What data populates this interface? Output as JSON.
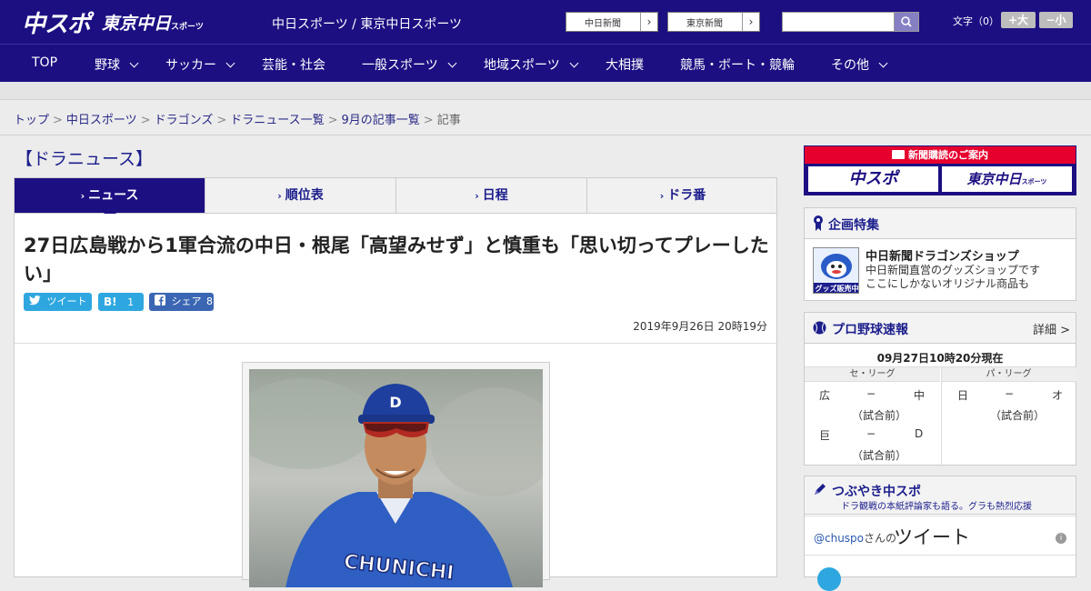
{
  "header": {
    "logo_main": "中スポ",
    "logo_tokyo": "東京中日",
    "logo_tokyo_sub": "スポーツ",
    "site_title": "中日スポーツ / 東京中日スポーツ",
    "btn_chunichi": "中日新聞",
    "btn_tokyo": "東京新聞",
    "btn_arrow": "›",
    "search_placeholder": "",
    "fontsize_label": "文字（0）",
    "fontsize_up": "+大",
    "fontsize_down": "−小"
  },
  "nav": [
    {
      "label": "TOP",
      "has_menu": false
    },
    {
      "label": "野球",
      "has_menu": true
    },
    {
      "label": "サッカー",
      "has_menu": true
    },
    {
      "label": "芸能・社会",
      "has_menu": false
    },
    {
      "label": "一般スポーツ",
      "has_menu": true
    },
    {
      "label": "地域スポーツ",
      "has_menu": true
    },
    {
      "label": "大相撲",
      "has_menu": false
    },
    {
      "label": "競馬・ボート・競輪",
      "has_menu": false
    },
    {
      "label": "その他",
      "has_menu": true
    }
  ],
  "breadcrumb": {
    "items": [
      "トップ",
      "中日スポーツ",
      "ドラゴンズ",
      "ドラニュース一覧",
      "9月の記事一覧"
    ],
    "current": "記事",
    "separator": ">"
  },
  "section": {
    "title": "【ドラニュース】"
  },
  "tabs": [
    {
      "label": "ニュース",
      "active": true
    },
    {
      "label": "順位表",
      "active": false
    },
    {
      "label": "日程",
      "active": false
    },
    {
      "label": "ドラ番",
      "active": false
    }
  ],
  "tab_mark": "›",
  "article": {
    "headline": "27日広島戦から1軍合流の中日・根尾「高望みせず」と慎重も「思い切ってプレーしたい」",
    "share_tweet": "ツイート",
    "share_hatena": "B!",
    "share_hatena_count": "1",
    "share_fb": "シェア",
    "share_fb_count": "8",
    "date": "2019年9月26日 20時19分",
    "photo_jersey_text": "CHUNICHI"
  },
  "sidebar": {
    "ad_top": "新聞購読のご案内",
    "ad_logo_1": "中スポ",
    "ad_logo_2": "東京中日",
    "ad_logo_2_sub": "スポーツ",
    "features_title": "企画特集",
    "feature_name": "中日新聞ドラゴンズショップ",
    "feature_desc_1": "中日新聞直営のグッズショップです",
    "feature_desc_2": "ここにしかないオリジナル商品も",
    "feature_img_label": "グッズ販売中",
    "baseball_title": "プロ野球速報",
    "baseball_detail": "詳細 >",
    "baseball_time": "09月27日10時20分現在",
    "central": "セ・リーグ",
    "pacific": "パ・リーグ",
    "games": [
      {
        "home": "広",
        "score": "−",
        "away": "中",
        "status": "（試合前）"
      },
      {
        "home": "巨",
        "score": "−",
        "away": "D",
        "status": "（試合前）"
      },
      {
        "home": "日",
        "score": "−",
        "away": "オ",
        "status": "（試合前）"
      }
    ],
    "tw_title": "つぶやき中スポ",
    "tw_sub": "ドラ観戦の本紙評論家も語る。グラも熱烈応援",
    "tw_handle": "@chuspo",
    "tw_handle_suffix": "さんの",
    "tw_big": "ツイート",
    "tw_info": "i"
  },
  "colors": {
    "brand_navy": "#1c0f82",
    "accent_red": "#e6002e",
    "twitter_blue": "#2ea7e0",
    "facebook_blue": "#3b66b3"
  }
}
